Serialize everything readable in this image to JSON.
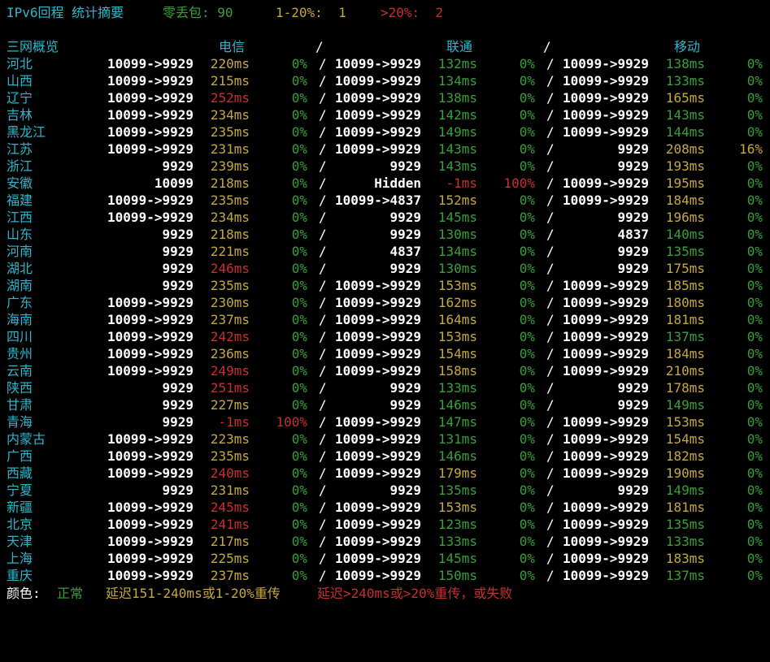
{
  "summary": {
    "title": "IPv6回程 统计摘要",
    "zero_loss_label": "零丢包: 90",
    "mid_loss_label": "1-20%:  1",
    "high_loss_label": ">20%:  2"
  },
  "header": {
    "region": "三网概览",
    "telecom": "电信",
    "sep": "/",
    "unicom": "联通",
    "mobile": "移动"
  },
  "colors": {
    "normal": "#38a038",
    "warn": "#c6a93c",
    "bad": "#c82f2f",
    "title": "#2cb6cc"
  },
  "rows": [
    {
      "region": "河北",
      "t": {
        "asn": "10099->9929",
        "lat": "220ms",
        "latc": "warn",
        "loss": "0%",
        "lossc": "normal"
      },
      "u": {
        "asn": "10099->9929",
        "lat": "132ms",
        "latc": "normal",
        "loss": "0%",
        "lossc": "normal"
      },
      "m": {
        "asn": "10099->9929",
        "lat": "138ms",
        "latc": "normal",
        "loss": "0%",
        "lossc": "normal"
      }
    },
    {
      "region": "山西",
      "t": {
        "asn": "10099->9929",
        "lat": "215ms",
        "latc": "warn",
        "loss": "0%",
        "lossc": "normal"
      },
      "u": {
        "asn": "10099->9929",
        "lat": "134ms",
        "latc": "normal",
        "loss": "0%",
        "lossc": "normal"
      },
      "m": {
        "asn": "10099->9929",
        "lat": "133ms",
        "latc": "normal",
        "loss": "0%",
        "lossc": "normal"
      }
    },
    {
      "region": "辽宁",
      "t": {
        "asn": "10099->9929",
        "lat": "252ms",
        "latc": "bad",
        "loss": "0%",
        "lossc": "normal"
      },
      "u": {
        "asn": "10099->9929",
        "lat": "138ms",
        "latc": "normal",
        "loss": "0%",
        "lossc": "normal"
      },
      "m": {
        "asn": "10099->9929",
        "lat": "165ms",
        "latc": "warn",
        "loss": "0%",
        "lossc": "normal"
      }
    },
    {
      "region": "吉林",
      "t": {
        "asn": "10099->9929",
        "lat": "234ms",
        "latc": "warn",
        "loss": "0%",
        "lossc": "normal"
      },
      "u": {
        "asn": "10099->9929",
        "lat": "142ms",
        "latc": "normal",
        "loss": "0%",
        "lossc": "normal"
      },
      "m": {
        "asn": "10099->9929",
        "lat": "143ms",
        "latc": "normal",
        "loss": "0%",
        "lossc": "normal"
      }
    },
    {
      "region": "黑龙江",
      "t": {
        "asn": "10099->9929",
        "lat": "235ms",
        "latc": "warn",
        "loss": "0%",
        "lossc": "normal"
      },
      "u": {
        "asn": "10099->9929",
        "lat": "149ms",
        "latc": "normal",
        "loss": "0%",
        "lossc": "normal"
      },
      "m": {
        "asn": "10099->9929",
        "lat": "144ms",
        "latc": "normal",
        "loss": "0%",
        "lossc": "normal"
      }
    },
    {
      "region": "江苏",
      "t": {
        "asn": "10099->9929",
        "lat": "231ms",
        "latc": "warn",
        "loss": "0%",
        "lossc": "normal"
      },
      "u": {
        "asn": "10099->9929",
        "lat": "143ms",
        "latc": "normal",
        "loss": "0%",
        "lossc": "normal"
      },
      "m": {
        "asn": "9929",
        "lat": "208ms",
        "latc": "warn",
        "loss": "16%",
        "lossc": "warn"
      }
    },
    {
      "region": "浙江",
      "t": {
        "asn": "9929",
        "lat": "239ms",
        "latc": "warn",
        "loss": "0%",
        "lossc": "normal"
      },
      "u": {
        "asn": "9929",
        "lat": "143ms",
        "latc": "normal",
        "loss": "0%",
        "lossc": "normal"
      },
      "m": {
        "asn": "9929",
        "lat": "193ms",
        "latc": "warn",
        "loss": "0%",
        "lossc": "normal"
      }
    },
    {
      "region": "安徽",
      "t": {
        "asn": "10099",
        "lat": "218ms",
        "latc": "warn",
        "loss": "0%",
        "lossc": "normal"
      },
      "u": {
        "asn": "Hidden",
        "lat": "-1ms",
        "latc": "bad",
        "loss": "100%",
        "lossc": "bad"
      },
      "m": {
        "asn": "10099->9929",
        "lat": "195ms",
        "latc": "warn",
        "loss": "0%",
        "lossc": "normal"
      }
    },
    {
      "region": "福建",
      "t": {
        "asn": "10099->9929",
        "lat": "235ms",
        "latc": "warn",
        "loss": "0%",
        "lossc": "normal"
      },
      "u": {
        "asn": "10099->4837",
        "lat": "152ms",
        "latc": "warn",
        "loss": "0%",
        "lossc": "normal"
      },
      "m": {
        "asn": "10099->9929",
        "lat": "184ms",
        "latc": "warn",
        "loss": "0%",
        "lossc": "normal"
      }
    },
    {
      "region": "江西",
      "t": {
        "asn": "10099->9929",
        "lat": "234ms",
        "latc": "warn",
        "loss": "0%",
        "lossc": "normal"
      },
      "u": {
        "asn": "9929",
        "lat": "145ms",
        "latc": "normal",
        "loss": "0%",
        "lossc": "normal"
      },
      "m": {
        "asn": "9929",
        "lat": "196ms",
        "latc": "warn",
        "loss": "0%",
        "lossc": "normal"
      }
    },
    {
      "region": "山东",
      "t": {
        "asn": "9929",
        "lat": "218ms",
        "latc": "warn",
        "loss": "0%",
        "lossc": "normal"
      },
      "u": {
        "asn": "9929",
        "lat": "130ms",
        "latc": "normal",
        "loss": "0%",
        "lossc": "normal"
      },
      "m": {
        "asn": "4837",
        "lat": "140ms",
        "latc": "normal",
        "loss": "0%",
        "lossc": "normal"
      }
    },
    {
      "region": "河南",
      "t": {
        "asn": "9929",
        "lat": "221ms",
        "latc": "warn",
        "loss": "0%",
        "lossc": "normal"
      },
      "u": {
        "asn": "4837",
        "lat": "134ms",
        "latc": "normal",
        "loss": "0%",
        "lossc": "normal"
      },
      "m": {
        "asn": "9929",
        "lat": "135ms",
        "latc": "normal",
        "loss": "0%",
        "lossc": "normal"
      }
    },
    {
      "region": "湖北",
      "t": {
        "asn": "9929",
        "lat": "246ms",
        "latc": "bad",
        "loss": "0%",
        "lossc": "normal"
      },
      "u": {
        "asn": "9929",
        "lat": "130ms",
        "latc": "normal",
        "loss": "0%",
        "lossc": "normal"
      },
      "m": {
        "asn": "9929",
        "lat": "175ms",
        "latc": "warn",
        "loss": "0%",
        "lossc": "normal"
      }
    },
    {
      "region": "湖南",
      "t": {
        "asn": "9929",
        "lat": "235ms",
        "latc": "warn",
        "loss": "0%",
        "lossc": "normal"
      },
      "u": {
        "asn": "10099->9929",
        "lat": "153ms",
        "latc": "warn",
        "loss": "0%",
        "lossc": "normal"
      },
      "m": {
        "asn": "10099->9929",
        "lat": "185ms",
        "latc": "warn",
        "loss": "0%",
        "lossc": "normal"
      }
    },
    {
      "region": "广东",
      "t": {
        "asn": "10099->9929",
        "lat": "230ms",
        "latc": "warn",
        "loss": "0%",
        "lossc": "normal"
      },
      "u": {
        "asn": "10099->9929",
        "lat": "162ms",
        "latc": "warn",
        "loss": "0%",
        "lossc": "normal"
      },
      "m": {
        "asn": "10099->9929",
        "lat": "180ms",
        "latc": "warn",
        "loss": "0%",
        "lossc": "normal"
      }
    },
    {
      "region": "海南",
      "t": {
        "asn": "10099->9929",
        "lat": "237ms",
        "latc": "warn",
        "loss": "0%",
        "lossc": "normal"
      },
      "u": {
        "asn": "10099->9929",
        "lat": "164ms",
        "latc": "warn",
        "loss": "0%",
        "lossc": "normal"
      },
      "m": {
        "asn": "10099->9929",
        "lat": "181ms",
        "latc": "warn",
        "loss": "0%",
        "lossc": "normal"
      }
    },
    {
      "region": "四川",
      "t": {
        "asn": "10099->9929",
        "lat": "242ms",
        "latc": "bad",
        "loss": "0%",
        "lossc": "normal"
      },
      "u": {
        "asn": "10099->9929",
        "lat": "153ms",
        "latc": "warn",
        "loss": "0%",
        "lossc": "normal"
      },
      "m": {
        "asn": "10099->9929",
        "lat": "137ms",
        "latc": "normal",
        "loss": "0%",
        "lossc": "normal"
      }
    },
    {
      "region": "贵州",
      "t": {
        "asn": "10099->9929",
        "lat": "236ms",
        "latc": "warn",
        "loss": "0%",
        "lossc": "normal"
      },
      "u": {
        "asn": "10099->9929",
        "lat": "154ms",
        "latc": "warn",
        "loss": "0%",
        "lossc": "normal"
      },
      "m": {
        "asn": "10099->9929",
        "lat": "184ms",
        "latc": "warn",
        "loss": "0%",
        "lossc": "normal"
      }
    },
    {
      "region": "云南",
      "t": {
        "asn": "10099->9929",
        "lat": "249ms",
        "latc": "bad",
        "loss": "0%",
        "lossc": "normal"
      },
      "u": {
        "asn": "10099->9929",
        "lat": "158ms",
        "latc": "warn",
        "loss": "0%",
        "lossc": "normal"
      },
      "m": {
        "asn": "10099->9929",
        "lat": "210ms",
        "latc": "warn",
        "loss": "0%",
        "lossc": "normal"
      }
    },
    {
      "region": "陕西",
      "t": {
        "asn": "9929",
        "lat": "251ms",
        "latc": "bad",
        "loss": "0%",
        "lossc": "normal"
      },
      "u": {
        "asn": "9929",
        "lat": "133ms",
        "latc": "normal",
        "loss": "0%",
        "lossc": "normal"
      },
      "m": {
        "asn": "9929",
        "lat": "178ms",
        "latc": "warn",
        "loss": "0%",
        "lossc": "normal"
      }
    },
    {
      "region": "甘肃",
      "t": {
        "asn": "9929",
        "lat": "227ms",
        "latc": "warn",
        "loss": "0%",
        "lossc": "normal"
      },
      "u": {
        "asn": "9929",
        "lat": "146ms",
        "latc": "normal",
        "loss": "0%",
        "lossc": "normal"
      },
      "m": {
        "asn": "9929",
        "lat": "149ms",
        "latc": "normal",
        "loss": "0%",
        "lossc": "normal"
      }
    },
    {
      "region": "青海",
      "t": {
        "asn": "9929",
        "lat": "-1ms",
        "latc": "bad",
        "loss": "100%",
        "lossc": "bad"
      },
      "u": {
        "asn": "10099->9929",
        "lat": "147ms",
        "latc": "normal",
        "loss": "0%",
        "lossc": "normal"
      },
      "m": {
        "asn": "10099->9929",
        "lat": "153ms",
        "latc": "warn",
        "loss": "0%",
        "lossc": "normal"
      }
    },
    {
      "region": "内蒙古",
      "t": {
        "asn": "10099->9929",
        "lat": "223ms",
        "latc": "warn",
        "loss": "0%",
        "lossc": "normal"
      },
      "u": {
        "asn": "10099->9929",
        "lat": "131ms",
        "latc": "normal",
        "loss": "0%",
        "lossc": "normal"
      },
      "m": {
        "asn": "10099->9929",
        "lat": "154ms",
        "latc": "warn",
        "loss": "0%",
        "lossc": "normal"
      }
    },
    {
      "region": "广西",
      "t": {
        "asn": "10099->9929",
        "lat": "235ms",
        "latc": "warn",
        "loss": "0%",
        "lossc": "normal"
      },
      "u": {
        "asn": "10099->9929",
        "lat": "146ms",
        "latc": "normal",
        "loss": "0%",
        "lossc": "normal"
      },
      "m": {
        "asn": "10099->9929",
        "lat": "182ms",
        "latc": "warn",
        "loss": "0%",
        "lossc": "normal"
      }
    },
    {
      "region": "西藏",
      "t": {
        "asn": "10099->9929",
        "lat": "240ms",
        "latc": "bad",
        "loss": "0%",
        "lossc": "normal"
      },
      "u": {
        "asn": "10099->9929",
        "lat": "179ms",
        "latc": "warn",
        "loss": "0%",
        "lossc": "normal"
      },
      "m": {
        "asn": "10099->9929",
        "lat": "190ms",
        "latc": "warn",
        "loss": "0%",
        "lossc": "normal"
      }
    },
    {
      "region": "宁夏",
      "t": {
        "asn": "9929",
        "lat": "231ms",
        "latc": "warn",
        "loss": "0%",
        "lossc": "normal"
      },
      "u": {
        "asn": "9929",
        "lat": "135ms",
        "latc": "normal",
        "loss": "0%",
        "lossc": "normal"
      },
      "m": {
        "asn": "9929",
        "lat": "149ms",
        "latc": "normal",
        "loss": "0%",
        "lossc": "normal"
      }
    },
    {
      "region": "新疆",
      "t": {
        "asn": "10099->9929",
        "lat": "245ms",
        "latc": "bad",
        "loss": "0%",
        "lossc": "normal"
      },
      "u": {
        "asn": "10099->9929",
        "lat": "153ms",
        "latc": "warn",
        "loss": "0%",
        "lossc": "normal"
      },
      "m": {
        "asn": "10099->9929",
        "lat": "181ms",
        "latc": "warn",
        "loss": "0%",
        "lossc": "normal"
      }
    },
    {
      "region": "北京",
      "t": {
        "asn": "10099->9929",
        "lat": "241ms",
        "latc": "bad",
        "loss": "0%",
        "lossc": "normal"
      },
      "u": {
        "asn": "10099->9929",
        "lat": "123ms",
        "latc": "normal",
        "loss": "0%",
        "lossc": "normal"
      },
      "m": {
        "asn": "10099->9929",
        "lat": "135ms",
        "latc": "normal",
        "loss": "0%",
        "lossc": "normal"
      }
    },
    {
      "region": "天津",
      "t": {
        "asn": "10099->9929",
        "lat": "217ms",
        "latc": "warn",
        "loss": "0%",
        "lossc": "normal"
      },
      "u": {
        "asn": "10099->9929",
        "lat": "133ms",
        "latc": "normal",
        "loss": "0%",
        "lossc": "normal"
      },
      "m": {
        "asn": "10099->9929",
        "lat": "133ms",
        "latc": "normal",
        "loss": "0%",
        "lossc": "normal"
      }
    },
    {
      "region": "上海",
      "t": {
        "asn": "10099->9929",
        "lat": "225ms",
        "latc": "warn",
        "loss": "0%",
        "lossc": "normal"
      },
      "u": {
        "asn": "10099->9929",
        "lat": "145ms",
        "latc": "normal",
        "loss": "0%",
        "lossc": "normal"
      },
      "m": {
        "asn": "10099->9929",
        "lat": "183ms",
        "latc": "warn",
        "loss": "0%",
        "lossc": "normal"
      }
    },
    {
      "region": "重庆",
      "t": {
        "asn": "10099->9929",
        "lat": "237ms",
        "latc": "warn",
        "loss": "0%",
        "lossc": "normal"
      },
      "u": {
        "asn": "10099->9929",
        "lat": "150ms",
        "latc": "normal",
        "loss": "0%",
        "lossc": "normal"
      },
      "m": {
        "asn": "10099->9929",
        "lat": "137ms",
        "latc": "normal",
        "loss": "0%",
        "lossc": "normal"
      }
    }
  ],
  "legend": {
    "label": "颜色:",
    "normal": "正常",
    "warn": "延迟151-240ms或1-20%重传",
    "bad": "延迟>240ms或>20%重传，或失败"
  }
}
